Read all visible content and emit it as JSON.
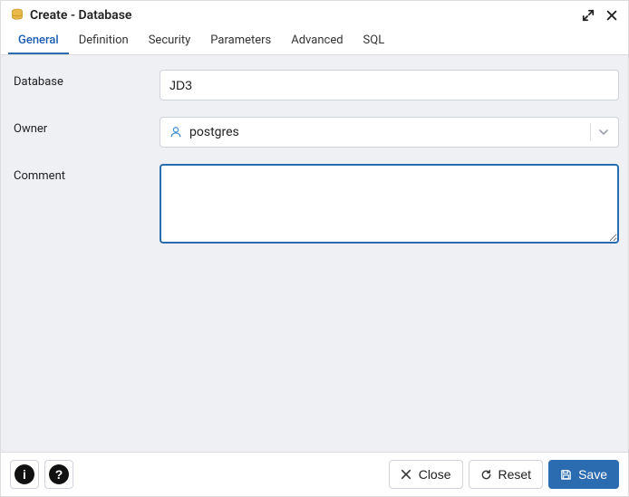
{
  "titlebar": {
    "title": "Create - Database"
  },
  "tabs": [
    {
      "label": "General",
      "active": true
    },
    {
      "label": "Definition",
      "active": false
    },
    {
      "label": "Security",
      "active": false
    },
    {
      "label": "Parameters",
      "active": false
    },
    {
      "label": "Advanced",
      "active": false
    },
    {
      "label": "SQL",
      "active": false
    }
  ],
  "form": {
    "database": {
      "label": "Database",
      "value": "JD3"
    },
    "owner": {
      "label": "Owner",
      "value": "postgres"
    },
    "comment": {
      "label": "Comment",
      "value": ""
    }
  },
  "footer": {
    "close": "Close",
    "reset": "Reset",
    "save": "Save"
  }
}
